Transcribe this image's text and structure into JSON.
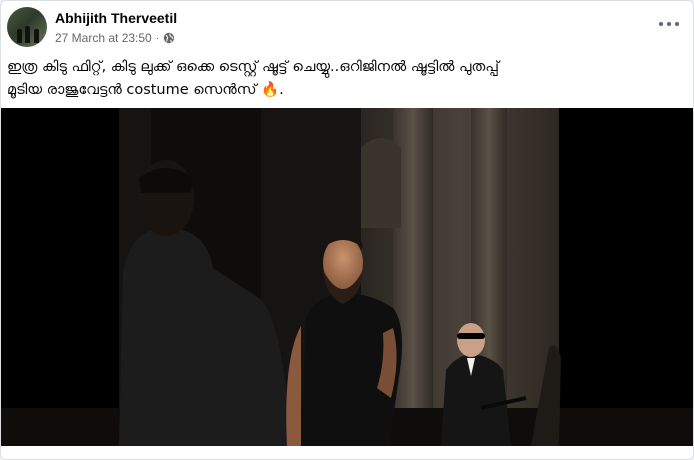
{
  "post": {
    "author": "Abhijith Therveetil",
    "timestamp": "27 March at 23:50",
    "separator": "·",
    "privacy_icon": "globe-icon",
    "menu_icon": "more-options-icon",
    "text_line1": "ഇത്ര കിടു ഫിറ്റ്, കിടു ലുക്ക് ഒക്കെ ടെസ്റ്റ് ഷൂട്ട് ചെയ്യു..ഒറിജിനൽ ഷൂട്ടിൽ പുതപ്പ്",
    "text_line2": "മൂടിയ രാജുവേട്ടൻ costume സെൻസ് 🔥."
  },
  "colors": {
    "text_primary": "#050505",
    "text_secondary": "#65676b",
    "card_border": "#dddfe2",
    "media_background": "#000000"
  }
}
